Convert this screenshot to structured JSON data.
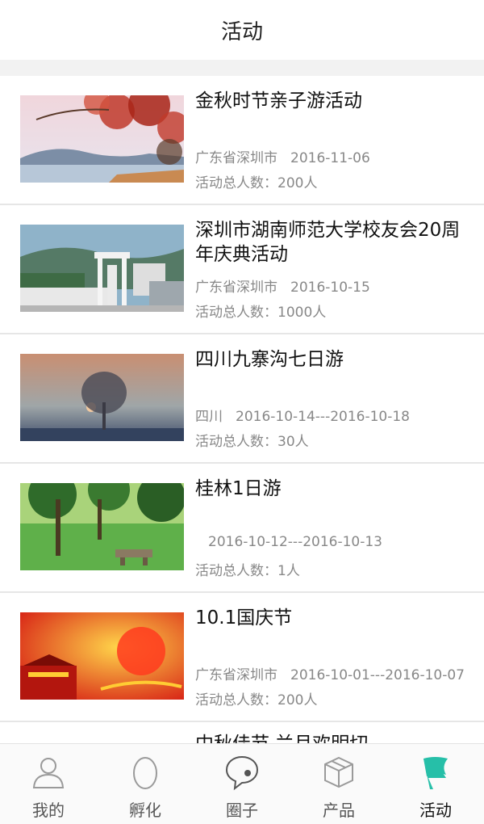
{
  "header": {
    "title": "活动"
  },
  "activities": [
    {
      "title": "金秋时节亲子游活动",
      "location": "广东省深圳市",
      "date": "2016-11-06",
      "count": "活动总人数：200人",
      "image": "autumn-lake"
    },
    {
      "title": "深圳市湖南师范大学校友会20周年庆典活动",
      "location": "广东省深圳市",
      "date": "2016-10-15",
      "count": "活动总人数：1000人",
      "image": "campus-gate"
    },
    {
      "title": "四川九寨沟七日游",
      "location": "四川",
      "date": "2016-10-14---2016-10-18",
      "count": "活动总人数：30人",
      "image": "misty-tree"
    },
    {
      "title": "桂林1日游",
      "location": "",
      "date": "2016-10-12---2016-10-13",
      "count": "活动总人数：1人",
      "image": "green-park"
    },
    {
      "title": "10.1国庆节",
      "location": "广东省深圳市",
      "date": "2016-10-01---2016-10-07",
      "count": "活动总人数：200人",
      "image": "national-day"
    },
    {
      "title": "中秋佳节 兰月欢明切",
      "location": "",
      "date": "",
      "count": "",
      "image": "partial"
    }
  ],
  "tabs": [
    {
      "label": "我的",
      "icon": "person-icon",
      "active": false
    },
    {
      "label": "孵化",
      "icon": "egg-icon",
      "active": false
    },
    {
      "label": "圈子",
      "icon": "chat-bubble-icon",
      "active": false
    },
    {
      "label": "产品",
      "icon": "box-icon",
      "active": false
    },
    {
      "label": "活动",
      "icon": "flag-icon",
      "active": true
    }
  ],
  "colors": {
    "accent": "#26bfa8",
    "icon_gray": "#9a9a9a",
    "meta_text": "#888888"
  }
}
